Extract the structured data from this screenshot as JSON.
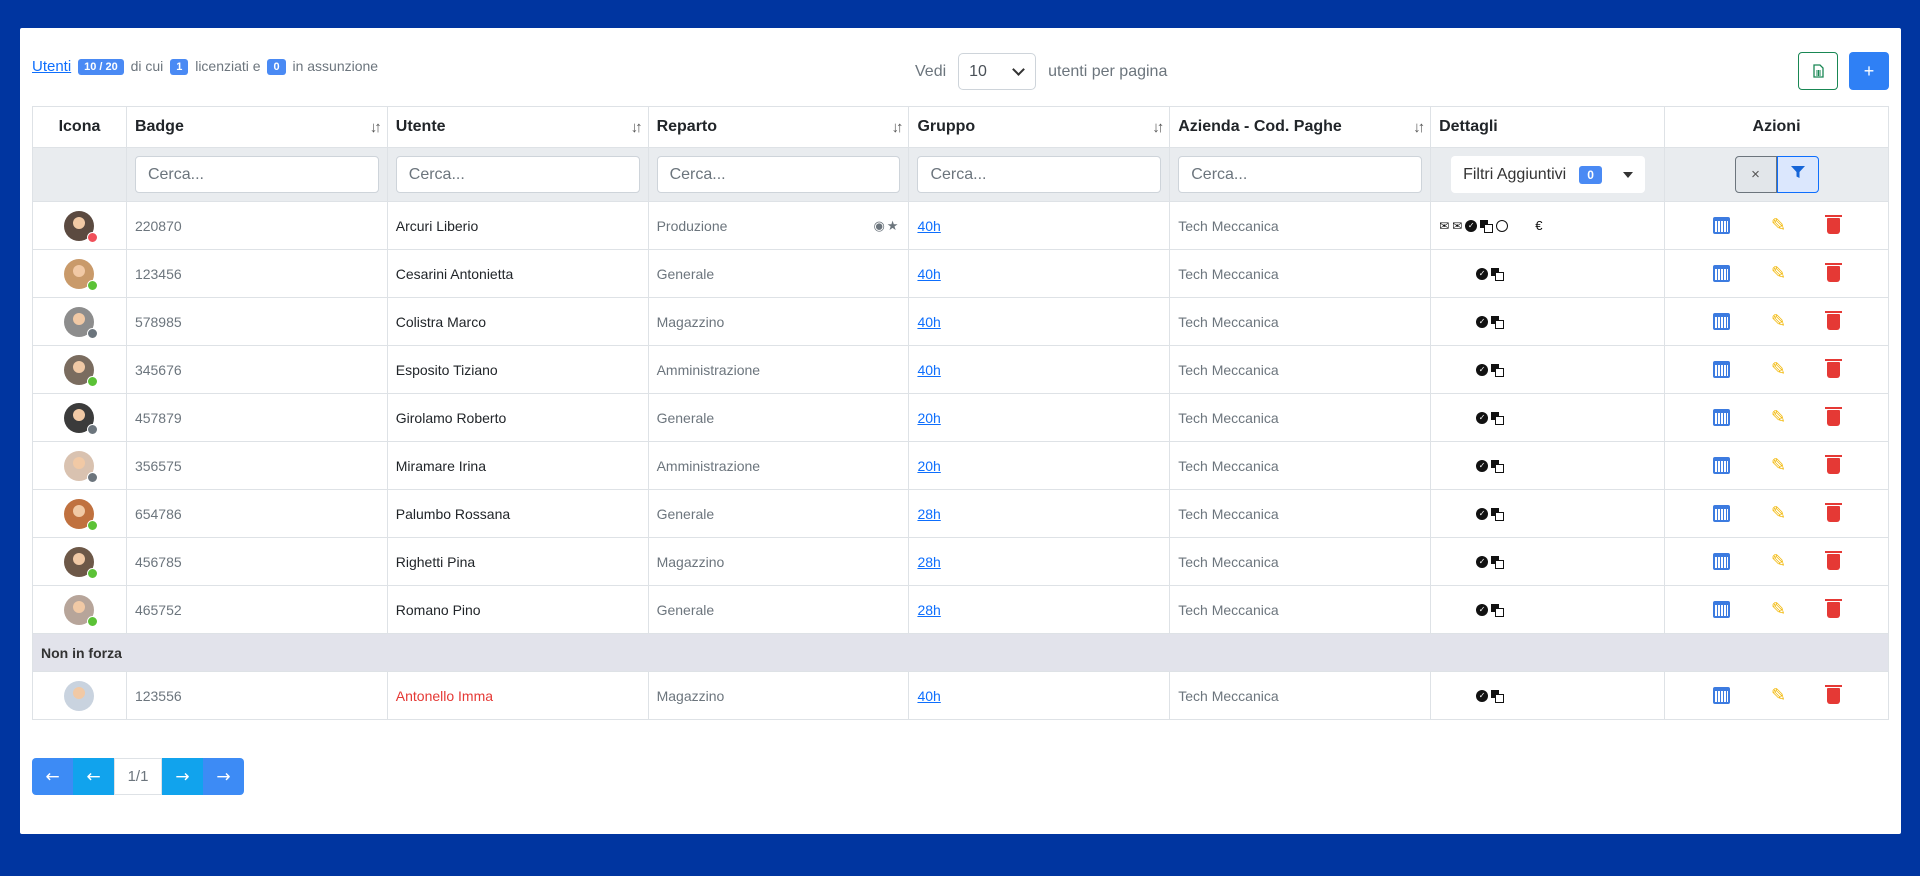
{
  "summary": {
    "link": "Utenti",
    "count_badge": "10 / 20",
    "text1": "di cui",
    "licenziati": "1",
    "text2": "licenziati e",
    "assunzione": "0",
    "text3": "in assunzione"
  },
  "per_page": {
    "label_before": "Vedi",
    "value": "10",
    "label_after": "utenti per pagina"
  },
  "toolbar": {
    "excel_icon": "spreadsheet-icon",
    "add_label": "+"
  },
  "columns": [
    "Icona",
    "Badge",
    "Utente",
    "Reparto",
    "Gruppo",
    "Azienda - Cod. Paghe",
    "Dettagli",
    "Azioni"
  ],
  "filters": {
    "placeholder": "Cerca...",
    "extra_label": "Filtri Aggiuntivi",
    "extra_count": "0",
    "clear_label": "×",
    "filter_icon": "funnel-icon"
  },
  "rows": [
    {
      "badge": "220870",
      "name": "Arcuri Liberio",
      "reparto": "Produzione",
      "gruppo": "40h",
      "azienda": "Tech Meccanica",
      "status_color": "#f0505a",
      "avatar_bg": "#5b4a40",
      "extra": true
    },
    {
      "badge": "123456",
      "name": "Cesarini Antonietta",
      "reparto": "Generale",
      "gruppo": "40h",
      "azienda": "Tech Meccanica",
      "status_color": "#5bc236",
      "avatar_bg": "#c99a6a"
    },
    {
      "badge": "578985",
      "name": "Colistra Marco",
      "reparto": "Magazzino",
      "gruppo": "40h",
      "azienda": "Tech Meccanica",
      "status_color": "#6c757d",
      "avatar_bg": "#8d8d8d"
    },
    {
      "badge": "345676",
      "name": "Esposito Tiziano",
      "reparto": "Amministrazione",
      "gruppo": "40h",
      "azienda": "Tech Meccanica",
      "status_color": "#5bc236",
      "avatar_bg": "#7a6c5f"
    },
    {
      "badge": "457879",
      "name": "Girolamo Roberto",
      "reparto": "Generale",
      "gruppo": "20h",
      "azienda": "Tech Meccanica",
      "status_color": "#6c757d",
      "avatar_bg": "#3b3b3b"
    },
    {
      "badge": "356575",
      "name": "Miramare Irina",
      "reparto": "Amministrazione",
      "gruppo": "20h",
      "azienda": "Tech Meccanica",
      "status_color": "#6c757d",
      "avatar_bg": "#d9c2b0"
    },
    {
      "badge": "654786",
      "name": "Palumbo Rossana",
      "reparto": "Generale",
      "gruppo": "28h",
      "azienda": "Tech Meccanica",
      "status_color": "#5bc236",
      "avatar_bg": "#c0713f"
    },
    {
      "badge": "456785",
      "name": "Righetti Pina",
      "reparto": "Magazzino",
      "gruppo": "28h",
      "azienda": "Tech Meccanica",
      "status_color": "#5bc236",
      "avatar_bg": "#6d5848"
    },
    {
      "badge": "465752",
      "name": "Romano Pino",
      "reparto": "Generale",
      "gruppo": "28h",
      "azienda": "Tech Meccanica",
      "status_color": "#5bc236",
      "avatar_bg": "#b7a59a"
    }
  ],
  "group_label": "Non in forza",
  "inactive_rows": [
    {
      "badge": "123556",
      "name": "Antonello Imma",
      "reparto": "Magazzino",
      "gruppo": "40h",
      "azienda": "Tech Meccanica",
      "avatar_bg": "#c9d3df"
    }
  ],
  "details_icons": {
    "euro": "€"
  },
  "pagination": {
    "first": "←",
    "prev": "←",
    "page": "1/1",
    "next": "→",
    "last": "→"
  }
}
